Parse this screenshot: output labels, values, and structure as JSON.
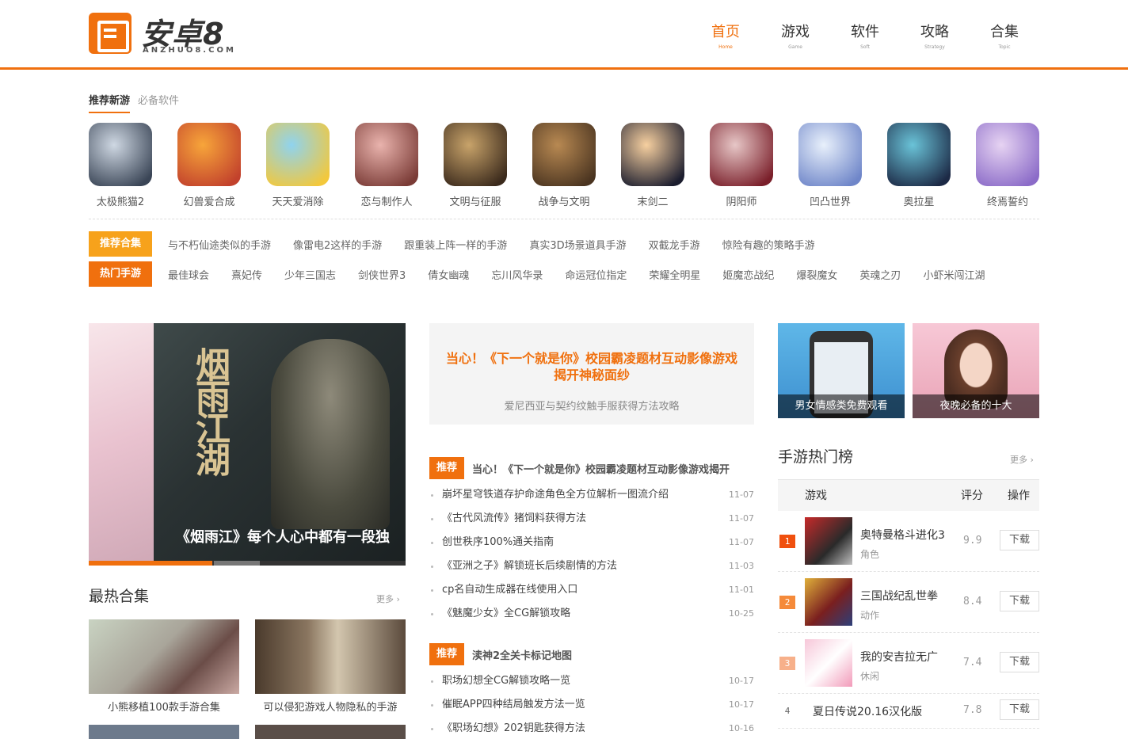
{
  "logo": {
    "text": "安卓8",
    "sub": "ANZHUO8.COM"
  },
  "nav": [
    {
      "label": "首页",
      "en": "Home",
      "active": true
    },
    {
      "label": "游戏",
      "en": "Game",
      "active": false
    },
    {
      "label": "软件",
      "en": "Soft",
      "active": false
    },
    {
      "label": "攻略",
      "en": "Strategy",
      "active": false
    },
    {
      "label": "合集",
      "en": "Topic",
      "active": false
    }
  ],
  "rec_tabs": [
    "推荐新游",
    "必备软件"
  ],
  "games": [
    {
      "name": "太极熊猫2",
      "icon": "panda-game-icon"
    },
    {
      "name": "幻兽爱合成",
      "icon": "beast-merge-game-icon"
    },
    {
      "name": "天天爱消除",
      "icon": "match-game-icon"
    },
    {
      "name": "恋与制作人",
      "icon": "romance-game-icon"
    },
    {
      "name": "文明与征服",
      "icon": "civilization-game-icon"
    },
    {
      "name": "战争与文明",
      "icon": "war-game-icon"
    },
    {
      "name": "末剑二",
      "icon": "sword-game-icon"
    },
    {
      "name": "阴阳师",
      "icon": "onmyoji-game-icon"
    },
    {
      "name": "凹凸世界",
      "icon": "aotu-game-icon"
    },
    {
      "name": "奥拉星",
      "icon": "aola-game-icon"
    },
    {
      "name": "终焉誓约",
      "icon": "oath-game-icon"
    }
  ],
  "tag_rows": [
    {
      "label": "推荐合集",
      "color": "#f7a21b",
      "links": [
        "与不朽仙途类似的手游",
        "像雷电2这样的手游",
        "跟重装上阵一样的手游",
        "真实3D场景道具手游",
        "双截龙手游",
        "惊险有趣的策略手游"
      ]
    },
    {
      "label": "热门手游",
      "color": "#f0700e",
      "links": [
        "最佳球会",
        "熹妃传",
        "少年三国志",
        "剑侠世界3",
        "倩女幽魂",
        "忘川风华录",
        "命运冠位指定",
        "荣耀全明星",
        "姬魔恋战纪",
        "爆裂魔女",
        "英魂之刃",
        "小虾米闯江湖"
      ]
    }
  ],
  "banner": {
    "title": "《烟雨江》每个人心中都有一段独",
    "calligraphy": "烟雨江湖"
  },
  "headline": {
    "title": "当心！《下一个就是你》校园霸凌题材互动影像游戏揭开神秘面纱",
    "sub": "爱尼西亚与契约纹触手服获得方法攻略"
  },
  "news_blocks": [
    {
      "badge": "推荐",
      "title": "当心！《下一个就是你》校园霸凌题材互动影像游戏揭开",
      "items": [
        {
          "t": "崩坏星穹铁道存护命途角色全方位解析一图流介绍",
          "d": "11-07"
        },
        {
          "t": "《古代风流传》猪饲料获得方法",
          "d": "11-07"
        },
        {
          "t": "创世秩序100%通关指南",
          "d": "11-07"
        },
        {
          "t": "《亚洲之子》解锁班长后续剧情的方法",
          "d": "11-03"
        },
        {
          "t": "cp名自动生成器在线使用入口",
          "d": "11-01"
        },
        {
          "t": "《魅魔少女》全CG解锁攻略",
          "d": "10-25"
        }
      ]
    },
    {
      "badge": "推荐",
      "title": "渎神2全关卡标记地图",
      "items": [
        {
          "t": "职场幻想全CG解锁攻略一览",
          "d": "10-17"
        },
        {
          "t": "催眠APP四种结局触发方法一览",
          "d": "10-17"
        },
        {
          "t": "《职场幻想》202钥匙获得方法",
          "d": "10-16"
        }
      ]
    }
  ],
  "ads": [
    {
      "caption": "男女情感类免费观看"
    },
    {
      "caption": "夜晚必备的十大"
    }
  ],
  "hot_list": {
    "title": "手游热门榜",
    "more": "更多",
    "headers": {
      "game": "游戏",
      "score": "评分",
      "action": "操作"
    },
    "rows": [
      {
        "rank": "1",
        "name": "奥特曼格斗进化3",
        "cat": "角色",
        "score": "9.9",
        "btn": "下载",
        "rank_color": "#f0500e",
        "icon": "ultraman-icon"
      },
      {
        "rank": "2",
        "name": "三国战纪乱世拳",
        "cat": "动作",
        "score": "8.4",
        "btn": "下载",
        "rank_color": "#f58a3a",
        "icon": "three-kingdoms-icon"
      },
      {
        "rank": "3",
        "name": "我的安吉拉无广",
        "cat": "休闲",
        "score": "7.4",
        "btn": "下载",
        "rank_color": "#f7b08a",
        "icon": "angela-icon"
      },
      {
        "rank": "4",
        "name": "夏日传说20.16汉化版",
        "cat": "",
        "score": "7.8",
        "btn": "下载",
        "rank_color": "",
        "icon": ""
      }
    ]
  },
  "collections": {
    "title": "最热合集",
    "more": "更多",
    "items": [
      {
        "name": "小熊移植100款手游合集"
      },
      {
        "name": "可以侵犯游戏人物隐私的手游"
      }
    ]
  }
}
